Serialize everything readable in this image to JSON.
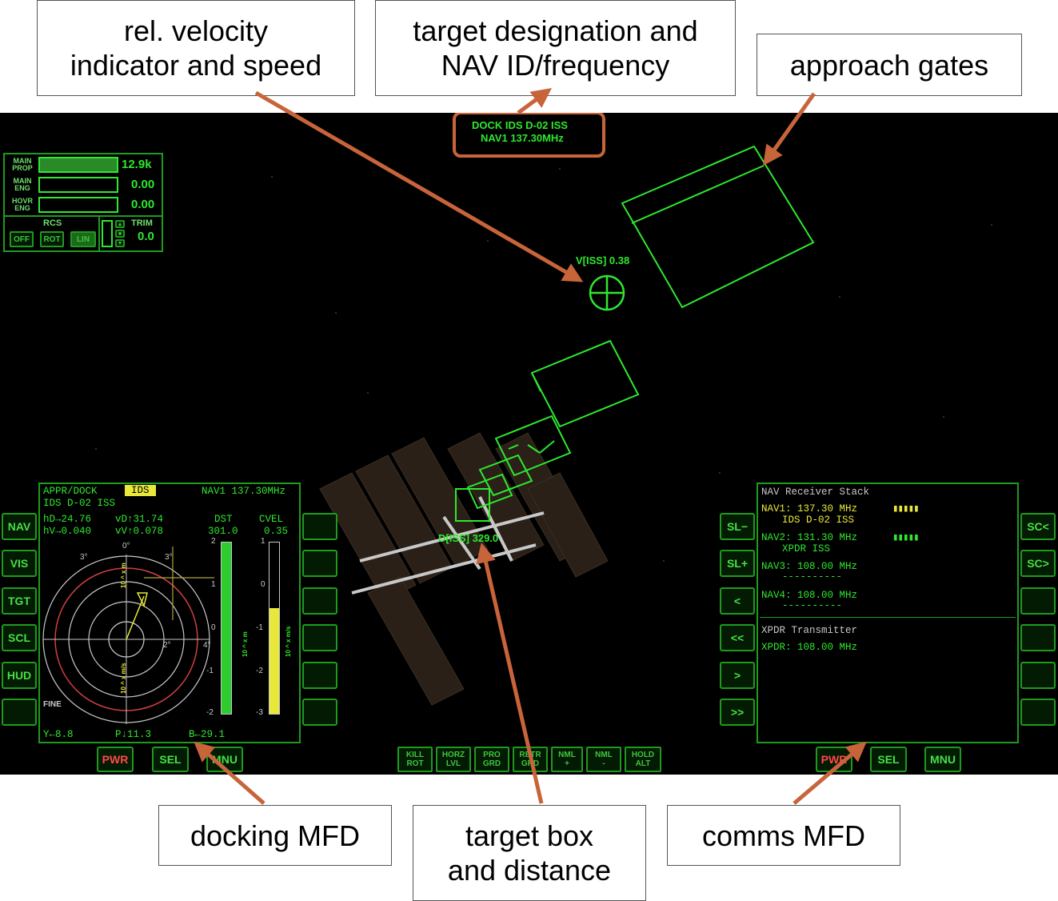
{
  "callouts": {
    "rel_velocity": "rel. velocity\nindicator and speed",
    "target_designation": "target designation and\nNAV ID/frequency",
    "approach_gates": "approach gates",
    "docking_mfd": "docking MFD",
    "target_box": "target box\nand distance",
    "comms_mfd": "comms MFD"
  },
  "colors": {
    "hud_green": "#2ee82e",
    "arrow": "#c8643a",
    "yellow": "#e8e83a",
    "red": "#ff4a4a"
  },
  "hud": {
    "target_line1": "DOCK  IDS  D-02  ISS",
    "target_line2": "NAV1  137.30MHz",
    "velocity_label": "V[ISS]  0.38",
    "distance_label": "D[ISS]  329.0"
  },
  "engine_panel": {
    "main_prop_label": "MAIN\nPROP",
    "main_prop_value": "12.9k",
    "main_prop_fraction": 1.0,
    "main_eng_label": "MAIN\nENG",
    "main_eng_value": "0.00",
    "hovr_eng_label": "HOVR\nENG",
    "hovr_eng_value": "0.00",
    "rcs_label": "RCS",
    "rcs_off": "OFF",
    "rcs_rot": "ROT",
    "rcs_lin": "LIN",
    "trim_label": "TRIM",
    "trim_value": "0.0"
  },
  "docking_mfd": {
    "title": "APPR/DOCK",
    "mode": "IDS",
    "nav": "NAV1 137.30MHz",
    "target": "IDS D-02 ISS",
    "hd": "hD→24.76",
    "hv": "hV→0.040",
    "vd": "vD↑31.74",
    "vv": "vV↑0.078",
    "dst_label": "DST",
    "dst_value": "301.0",
    "cvel_label": "CVEL",
    "cvel_value": "0.35",
    "fine_label": "FINE",
    "y_value": "Y←8.8",
    "p_value": "P↓11.3",
    "b_value": "B←29.1",
    "deg_0": "0°",
    "deg_2": "2°",
    "deg_3": "3°",
    "deg_4": "4°",
    "dst_ticks": [
      "2",
      "1",
      "0",
      "-1",
      "-2"
    ],
    "cvel_ticks": [
      "1",
      "0",
      "-1",
      "-2",
      "-3"
    ],
    "axis_unit_m": "10 ^ x m",
    "axis_unit_ms": "10 ^ x m/s",
    "left_buttons": [
      "NAV",
      "VIS",
      "TGT",
      "SCL",
      "HUD",
      ""
    ],
    "bottom_buttons": [
      "PWR",
      "SEL",
      "MNU"
    ]
  },
  "comms_mfd": {
    "title": "NAV Receiver Stack",
    "nav1": "NAV1: 137.30 MHz",
    "nav1_id": "IDS D-02 ISS",
    "nav2": "NAV2: 131.30 MHz",
    "nav2_id": "XPDR ISS",
    "nav3": "NAV3: 108.00 MHz",
    "nav3_id": "----------",
    "nav4": "NAV4: 108.00 MHz",
    "nav4_id": "----------",
    "xpdr_title": "XPDR Transmitter",
    "xpdr": "XPDR: 108.00 MHz",
    "left_buttons": [
      "SL−",
      "SL+",
      "<",
      "<<",
      ">",
      ">>"
    ],
    "right_buttons": [
      "SC<",
      "SC>",
      "",
      "",
      "",
      ""
    ],
    "bottom_buttons": [
      "PWR",
      "SEL",
      "MNU"
    ]
  },
  "autopilot_buttons": [
    "KILL\nROT",
    "HORZ\nLVL",
    "PRO\nGRD",
    "RETR\nGRD",
    "NML\n+",
    "NML\n-",
    "HOLD\nALT"
  ]
}
